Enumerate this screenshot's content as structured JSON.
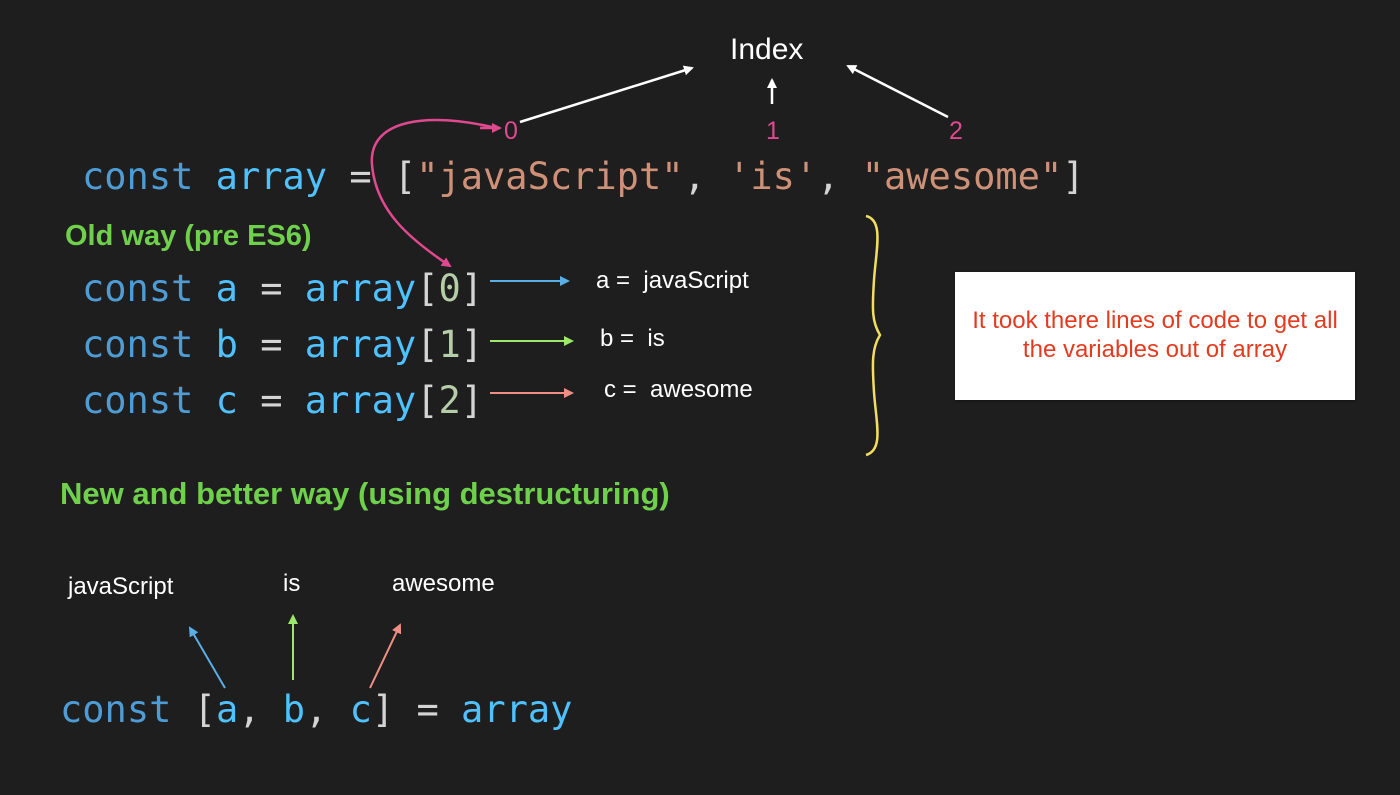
{
  "index": {
    "title": "Index",
    "numbers": [
      "0",
      "1",
      "2"
    ]
  },
  "array_decl": {
    "kw": "const",
    "name": "array",
    "eq": "=",
    "open": "[",
    "s1": "\"javaScript\"",
    "s2": "'is'",
    "s3": "\"awesome\"",
    "comma": ",",
    "close": "]"
  },
  "old_way": {
    "heading": "Old way (pre ES6)",
    "lines": [
      {
        "kw": "const",
        "name": "a",
        "eq": "=",
        "ref": "array",
        "open": "[",
        "idx": "0",
        "close": "]",
        "result": "a =  javaScript"
      },
      {
        "kw": "const",
        "name": "b",
        "eq": "=",
        "ref": "array",
        "open": "[",
        "idx": "1",
        "close": "]",
        "result": "b =  is"
      },
      {
        "kw": "const",
        "name": "c",
        "eq": "=",
        "ref": "array",
        "open": "[",
        "idx": "2",
        "close": "]",
        "result": "c =  awesome"
      }
    ],
    "note": "It took there lines of code to get all the variables out of array"
  },
  "new_way": {
    "heading": "New and better way (using destructuring)",
    "labels": [
      "javaScript",
      "is",
      "awesome"
    ],
    "code": {
      "kw": "const",
      "open": "[",
      "a": "a",
      "b": "b",
      "c": "c",
      "comma": ",",
      "close": "]",
      "eq": "=",
      "ref": "array"
    }
  },
  "colors": {
    "background": "#1e1e1e",
    "keyword": "#4e9cd6",
    "variable": "#4fc1ff",
    "string": "#ce9178",
    "number": "#b5cea8",
    "heading": "#6fd04c",
    "index_number": "#e0498f",
    "arrow_a": "#5aaee6",
    "arrow_b": "#9be86a",
    "arrow_c": "#ef8f83",
    "brace": "#f1dd60",
    "note_text": "#e33b1f"
  }
}
